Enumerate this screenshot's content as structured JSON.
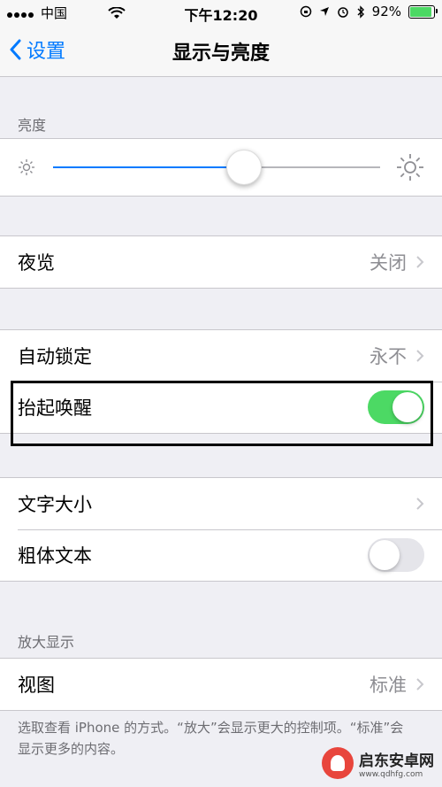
{
  "status_bar": {
    "carrier": "中国",
    "time": "下午12:20",
    "battery_percent": "92%",
    "battery_level": 0.92,
    "icons": [
      "wifi-icon",
      "orientation-lock-icon",
      "location-icon",
      "alarm-icon",
      "bluetooth-icon",
      "battery-icon"
    ]
  },
  "nav": {
    "back_label": "设置",
    "title": "显示与亮度"
  },
  "brightness": {
    "section_label": "亮度",
    "level": 0.58
  },
  "night_shift": {
    "label": "夜览",
    "value": "关闭"
  },
  "lock_group": {
    "auto_lock": {
      "label": "自动锁定",
      "value": "永不"
    },
    "raise_to_wake": {
      "label": "抬起唤醒",
      "on": true
    }
  },
  "text_group": {
    "text_size": {
      "label": "文字大小"
    },
    "bold_text": {
      "label": "粗体文本",
      "on": false
    }
  },
  "zoom": {
    "section_label": "放大显示",
    "view": {
      "label": "视图",
      "value": "标准"
    },
    "footer": "选取查看 iPhone 的方式。“放大”会显示更大的控制项。“标准”会显示更多的内容。"
  },
  "watermark": {
    "title": "启东安卓网",
    "url": "www.qdhfg.com"
  },
  "colors": {
    "accent": "#007aff",
    "toggle_on": "#4cd964",
    "background": "#efeff4"
  }
}
